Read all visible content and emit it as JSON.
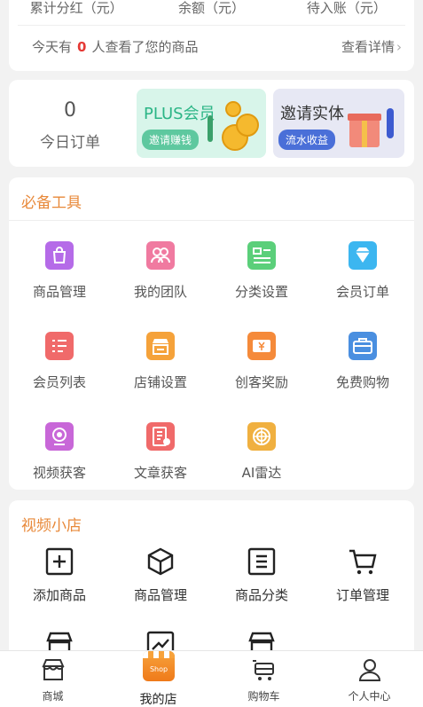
{
  "stats": {
    "labels": [
      "累计分红（元）",
      "余额（元）",
      "待入账（元）"
    ],
    "viewed_prefix": "今天有",
    "viewed_count": "0",
    "viewed_suffix": "人查看了您的商品",
    "detail_link": "查看详情",
    "detail_chevron": "›"
  },
  "orders": {
    "count": "0",
    "label": "今日订单"
  },
  "banners": [
    {
      "title": "PLUS会员",
      "pill": "邀请赚钱"
    },
    {
      "title": "邀请实体",
      "pill": "流水收益"
    }
  ],
  "tools": {
    "title": "必备工具",
    "items": [
      {
        "label": "商品管理",
        "icon": "shopping-bag-icon",
        "color": "#b56be8"
      },
      {
        "label": "我的团队",
        "icon": "team-icon",
        "color": "#f07aa0"
      },
      {
        "label": "分类设置",
        "icon": "category-icon",
        "color": "#5bcf7a"
      },
      {
        "label": "会员订单",
        "icon": "diamond-icon",
        "color": "#3cb6f0"
      },
      {
        "label": "会员列表",
        "icon": "member-list-icon",
        "color": "#f06a6a"
      },
      {
        "label": "店铺设置",
        "icon": "store-settings-icon",
        "color": "#f5a23a"
      },
      {
        "label": "创客奖励",
        "icon": "ticket-icon",
        "color": "#f58a3a"
      },
      {
        "label": "免费购物",
        "icon": "toolbox-icon",
        "color": "#4a8fe0"
      },
      {
        "label": "视频获客",
        "icon": "video-camera-icon",
        "color": "#c867d8"
      },
      {
        "label": "文章获客",
        "icon": "article-icon",
        "color": "#f06a6a"
      },
      {
        "label": "AI雷达",
        "icon": "radar-icon",
        "color": "#f0b040"
      }
    ]
  },
  "shop": {
    "title": "视频小店",
    "items": [
      {
        "label": "添加商品",
        "icon": "add-product-icon"
      },
      {
        "label": "商品管理",
        "icon": "box-icon"
      },
      {
        "label": "商品分类",
        "icon": "category-list-icon"
      },
      {
        "label": "订单管理",
        "icon": "cart-icon"
      }
    ]
  },
  "nav": {
    "items": [
      {
        "label": "商城",
        "icon": "mall-icon"
      },
      {
        "label": "我的店",
        "icon": "my-shop-icon",
        "badge": "Shop"
      },
      {
        "label": "购物车",
        "icon": "cart-icon"
      },
      {
        "label": "个人中心",
        "icon": "user-icon"
      }
    ]
  }
}
